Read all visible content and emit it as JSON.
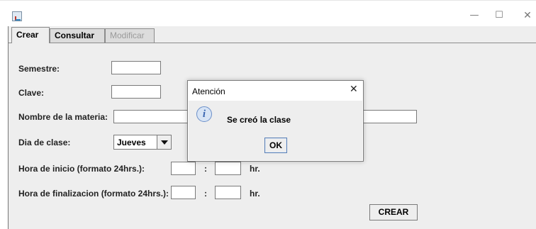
{
  "window": {
    "minimize_glyph": "—",
    "maximize_glyph": "☐",
    "close_glyph": "✕",
    "icon": "java-app-icon"
  },
  "tabs": [
    {
      "label": "Crear",
      "selected": true,
      "enabled": true
    },
    {
      "label": "Consultar",
      "selected": false,
      "enabled": true
    },
    {
      "label": "Modificar",
      "selected": false,
      "enabled": false
    }
  ],
  "form": {
    "semestre_label": "Semestre:",
    "semestre_value": "",
    "clave_label": "Clave:",
    "clave_value": "",
    "materia_label": "Nombre de la materia:",
    "materia_value": "",
    "dia_label": "Dia de clase:",
    "dia_value": "Jueves",
    "inicio_label": "Hora de inicio (formato 24hrs.):",
    "inicio_hour": "",
    "inicio_colon": ":",
    "inicio_minute": "",
    "inicio_unit": "hr.",
    "fin_label": "Hora de finalizacion (formato 24hrs.):",
    "fin_hour": "",
    "fin_colon": ":",
    "fin_minute": "",
    "fin_unit": "hr.",
    "crear_button": "CREAR"
  },
  "dialog": {
    "title": "Atención",
    "close_glyph": "✕",
    "icon": "info-icon",
    "icon_glyph": "i",
    "message": "Se creó la clase",
    "ok_button": "OK"
  }
}
